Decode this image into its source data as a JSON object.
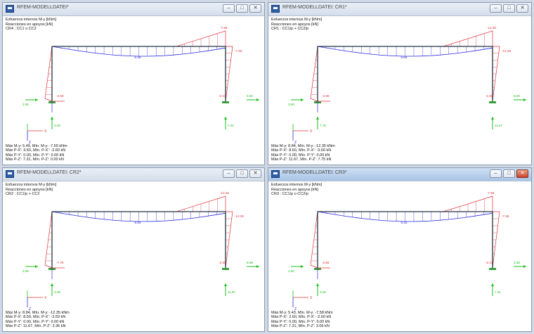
{
  "windows": [
    {
      "title": "RFEM-MODELLDATEI*",
      "active": false,
      "header": [
        "Esfuerzos internos M-y [kNm]",
        "Reacciones en apoyos [kN]",
        "CR4 : CC1 o CC2"
      ],
      "footer": [
        "Máx M-y: 5.49, Mín. M-y: -7.55 kNm",
        "Máx P-X': 3.60, Mín. P-X': -2.60 kN",
        "Máx P-Y': 0.00, Mín. P-Y': 0.00 kN",
        "Máx P-Z': 7.31, Mín. P-Z': 0.00 kN"
      ],
      "labels": {
        "mid": "5.49",
        "top_right": "-7.55",
        "right_col": "-7.55",
        "left_base": "-2.59",
        "right_base": "-2.27",
        "react_left_x": "2.60",
        "react_right_x": "3.60",
        "react_left_z": "0.00",
        "react_right_z": "7.31"
      }
    },
    {
      "title": "RFEM-MODELLDATEI: CR1*",
      "active": false,
      "header": [
        "Esfuerzos internos M-y [kNm]",
        "Reacciones en apoyos [kN]",
        "CR1 : CC1/p + CC2/p"
      ],
      "footer": [
        "Máx M-y: 8.84, Mín. M-y: -12.35 kNm",
        "Máx P-X': 8.60, Mín. P-X': -3.60 kN",
        "Máx P-Y': 0.00, Mín. P-Y': 0.00 kN",
        "Máx P-Z': 11.67, Mín. P-Z': 7.75 kN"
      ],
      "labels": {
        "mid": "8.84",
        "top_right": "-12.35",
        "right_col": "-12.35",
        "left_base": "-2.59",
        "right_base": "-2.59",
        "react_left_x": "3.60",
        "react_right_x": "8.60",
        "react_left_z": "7.75",
        "react_right_z": "11.67"
      }
    },
    {
      "title": "RFEM-MODELLDATEI: CR2*",
      "active": false,
      "header": [
        "Esfuerzos internos M-y [kNm]",
        "Reacciones en apoyos [kN]",
        "CR2 : CC1/p + CC2"
      ],
      "footer": [
        "Máx M-y: 8.84, Mín. M-y: -12.35 kNm",
        "Máx P-X': 8.59, Mín. P-X': -3.59 kN",
        "Máx P-Y': 0.00, Mín. P-Y': 0.00 kN",
        "Máx P-Z': 11.67, Mín. P-Z': 3.36 kN"
      ],
      "labels": {
        "mid": "8.84",
        "top_right": "-12.35",
        "right_col": "-12.35",
        "left_base": "-7.79",
        "right_base": "-2.59",
        "react_left_x": "3.59",
        "react_right_x": "8.59",
        "react_left_z": "3.36",
        "react_right_z": "11.67"
      }
    },
    {
      "title": "RFEM-MODELLDATEI: CR3*",
      "active": true,
      "header": [
        "Esfuerzos internos M-y [kNm]",
        "Reacciones en apoyos [kN]",
        "CR3 : CC1/p o CC2/p"
      ],
      "footer": [
        "Máx M-y: 5.43, Mín. M-y: -7.58 kNm",
        "Máx P-X': 2.60, Mín. P-X': -2.60 kN",
        "Máx P-Y': 0.00, Mín. P-Y': 0.00 kN",
        "Máx P-Z': 7.31, Mín. P-Z': 3.06 kN"
      ],
      "labels": {
        "mid": "5.43",
        "top_right": "-7.58",
        "right_col": "-7.58",
        "left_base": "-2.59",
        "right_base": "-2.27",
        "react_left_x": "2.60",
        "react_right_x": "2.60",
        "react_left_z": "3.06",
        "react_right_z": "7.31"
      }
    }
  ],
  "colors": {
    "moment_positive": "#2b2be0",
    "moment_negative": "#e0323a",
    "reaction": "#1bbf1b",
    "frame": "#223344",
    "axis_x": "#e0323a",
    "axis_z": "#2b2be0"
  },
  "axis_labels": {
    "x": "X",
    "z": "Z"
  }
}
